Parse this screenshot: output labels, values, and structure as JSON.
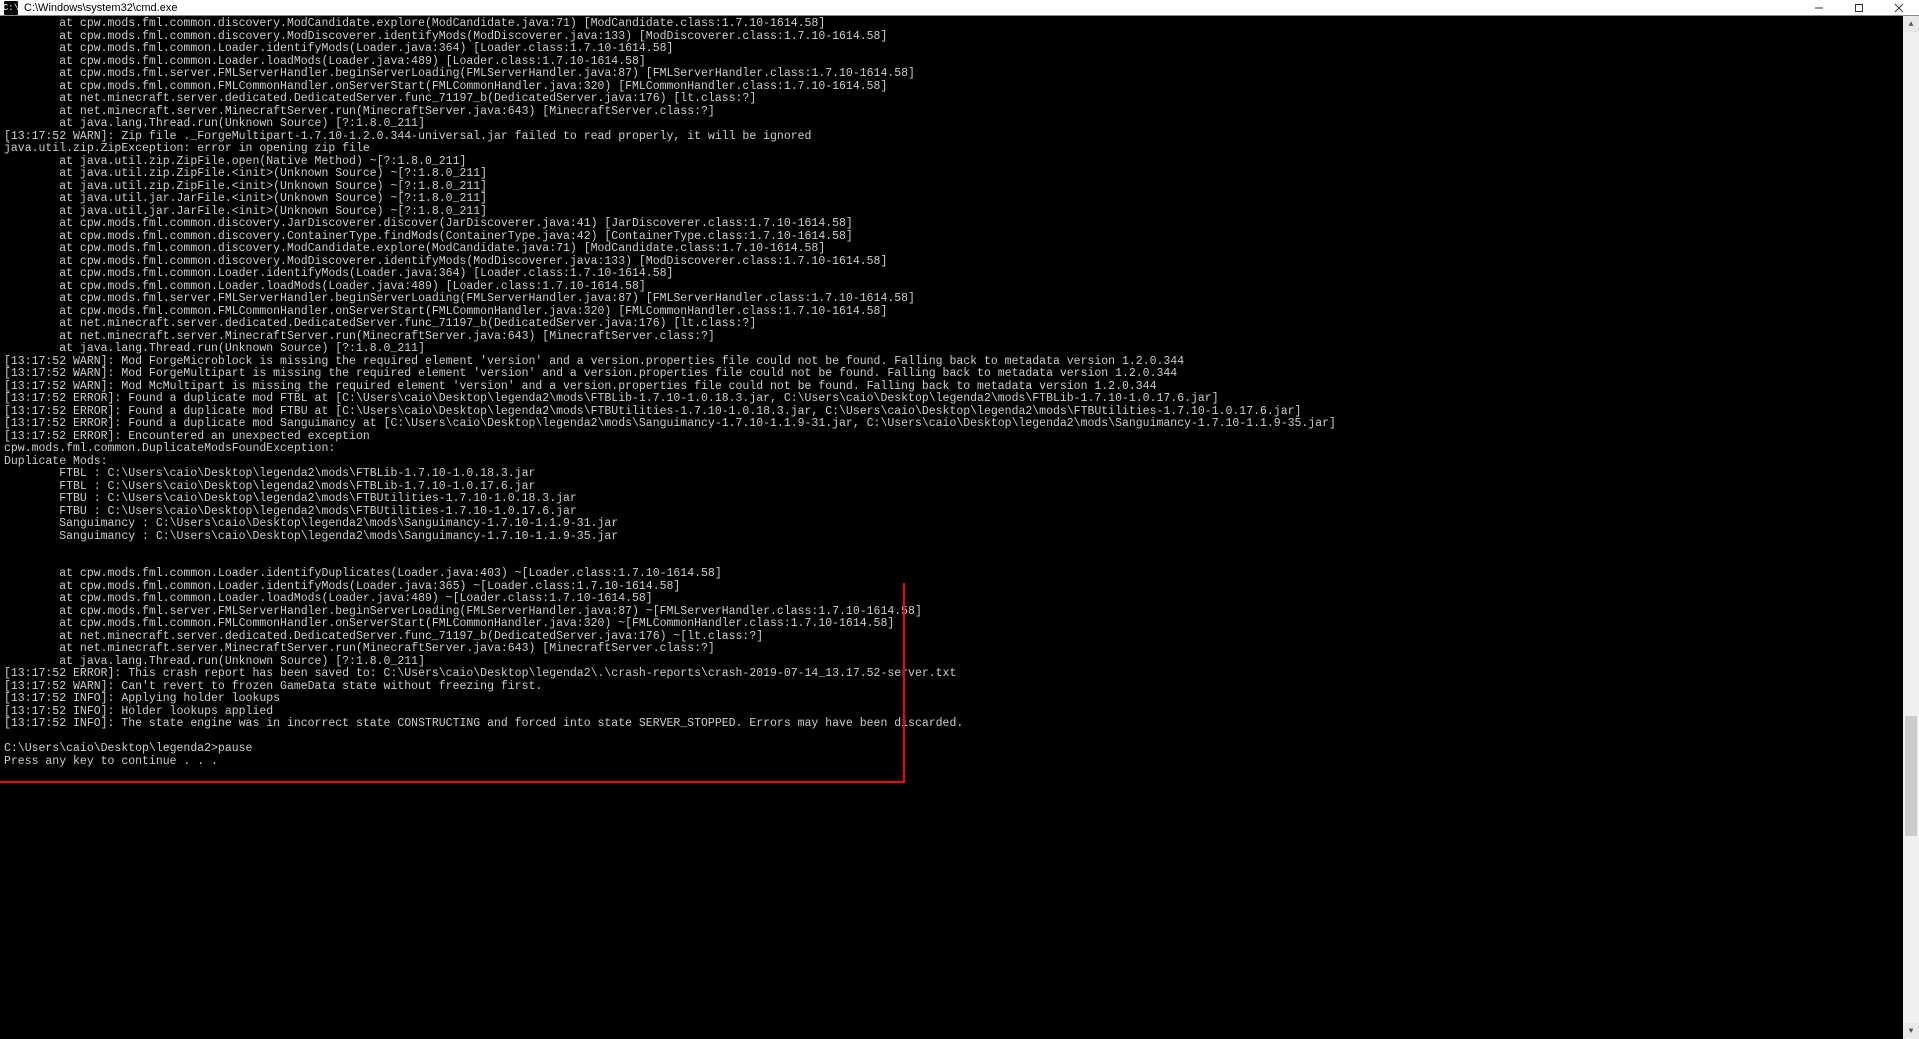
{
  "titlebar": {
    "icon_label": "C:\\",
    "title": "C:\\Windows\\system32\\cmd.exe"
  },
  "win_controls": {
    "minimize": "minimize-icon",
    "maximize": "maximize-icon",
    "close": "close-icon"
  },
  "highlight": {
    "color": "#ff0000",
    "present": true
  },
  "console_lines": [
    "        at cpw.mods.fml.common.discovery.ModCandidate.explore(ModCandidate.java:71) [ModCandidate.class:1.7.10-1614.58]",
    "        at cpw.mods.fml.common.discovery.ModDiscoverer.identifyMods(ModDiscoverer.java:133) [ModDiscoverer.class:1.7.10-1614.58]",
    "        at cpw.mods.fml.common.Loader.identifyMods(Loader.java:364) [Loader.class:1.7.10-1614.58]",
    "        at cpw.mods.fml.common.Loader.loadMods(Loader.java:489) [Loader.class:1.7.10-1614.58]",
    "        at cpw.mods.fml.server.FMLServerHandler.beginServerLoading(FMLServerHandler.java:87) [FMLServerHandler.class:1.7.10-1614.58]",
    "        at cpw.mods.fml.common.FMLCommonHandler.onServerStart(FMLCommonHandler.java:320) [FMLCommonHandler.class:1.7.10-1614.58]",
    "        at net.minecraft.server.dedicated.DedicatedServer.func_71197_b(DedicatedServer.java:176) [lt.class:?]",
    "        at net.minecraft.server.MinecraftServer.run(MinecraftServer.java:643) [MinecraftServer.class:?]",
    "        at java.lang.Thread.run(Unknown Source) [?:1.8.0_211]",
    "[13:17:52 WARN]: Zip file ._ForgeMultipart-1.7.10-1.2.0.344-universal.jar failed to read properly, it will be ignored",
    "java.util.zip.ZipException: error in opening zip file",
    "        at java.util.zip.ZipFile.open(Native Method) ~[?:1.8.0_211]",
    "        at java.util.zip.ZipFile.<init>(Unknown Source) ~[?:1.8.0_211]",
    "        at java.util.zip.ZipFile.<init>(Unknown Source) ~[?:1.8.0_211]",
    "        at java.util.jar.JarFile.<init>(Unknown Source) ~[?:1.8.0_211]",
    "        at java.util.jar.JarFile.<init>(Unknown Source) ~[?:1.8.0_211]",
    "        at cpw.mods.fml.common.discovery.JarDiscoverer.discover(JarDiscoverer.java:41) [JarDiscoverer.class:1.7.10-1614.58]",
    "        at cpw.mods.fml.common.discovery.ContainerType.findMods(ContainerType.java:42) [ContainerType.class:1.7.10-1614.58]",
    "        at cpw.mods.fml.common.discovery.ModCandidate.explore(ModCandidate.java:71) [ModCandidate.class:1.7.10-1614.58]",
    "        at cpw.mods.fml.common.discovery.ModDiscoverer.identifyMods(ModDiscoverer.java:133) [ModDiscoverer.class:1.7.10-1614.58]",
    "        at cpw.mods.fml.common.Loader.identifyMods(Loader.java:364) [Loader.class:1.7.10-1614.58]",
    "        at cpw.mods.fml.common.Loader.loadMods(Loader.java:489) [Loader.class:1.7.10-1614.58]",
    "        at cpw.mods.fml.server.FMLServerHandler.beginServerLoading(FMLServerHandler.java:87) [FMLServerHandler.class:1.7.10-1614.58]",
    "        at cpw.mods.fml.common.FMLCommonHandler.onServerStart(FMLCommonHandler.java:320) [FMLCommonHandler.class:1.7.10-1614.58]",
    "        at net.minecraft.server.dedicated.DedicatedServer.func_71197_b(DedicatedServer.java:176) [lt.class:?]",
    "        at net.minecraft.server.MinecraftServer.run(MinecraftServer.java:643) [MinecraftServer.class:?]",
    "        at java.lang.Thread.run(Unknown Source) [?:1.8.0_211]",
    "[13:17:52 WARN]: Mod ForgeMicroblock is missing the required element 'version' and a version.properties file could not be found. Falling back to metadata version 1.2.0.344",
    "[13:17:52 WARN]: Mod ForgeMultipart is missing the required element 'version' and a version.properties file could not be found. Falling back to metadata version 1.2.0.344",
    "[13:17:52 WARN]: Mod McMultipart is missing the required element 'version' and a version.properties file could not be found. Falling back to metadata version 1.2.0.344",
    "[13:17:52 ERROR]: Found a duplicate mod FTBL at [C:\\Users\\caio\\Desktop\\legenda2\\mods\\FTBLib-1.7.10-1.0.18.3.jar, C:\\Users\\caio\\Desktop\\legenda2\\mods\\FTBLib-1.7.10-1.0.17.6.jar]",
    "[13:17:52 ERROR]: Found a duplicate mod FTBU at [C:\\Users\\caio\\Desktop\\legenda2\\mods\\FTBUtilities-1.7.10-1.0.18.3.jar, C:\\Users\\caio\\Desktop\\legenda2\\mods\\FTBUtilities-1.7.10-1.0.17.6.jar]",
    "[13:17:52 ERROR]: Found a duplicate mod Sanguimancy at [C:\\Users\\caio\\Desktop\\legenda2\\mods\\Sanguimancy-1.7.10-1.1.9-31.jar, C:\\Users\\caio\\Desktop\\legenda2\\mods\\Sanguimancy-1.7.10-1.1.9-35.jar]",
    "[13:17:52 ERROR]: Encountered an unexpected exception",
    "cpw.mods.fml.common.DuplicateModsFoundException:",
    "Duplicate Mods:",
    "        FTBL : C:\\Users\\caio\\Desktop\\legenda2\\mods\\FTBLib-1.7.10-1.0.18.3.jar",
    "        FTBL : C:\\Users\\caio\\Desktop\\legenda2\\mods\\FTBLib-1.7.10-1.0.17.6.jar",
    "        FTBU : C:\\Users\\caio\\Desktop\\legenda2\\mods\\FTBUtilities-1.7.10-1.0.18.3.jar",
    "        FTBU : C:\\Users\\caio\\Desktop\\legenda2\\mods\\FTBUtilities-1.7.10-1.0.17.6.jar",
    "        Sanguimancy : C:\\Users\\caio\\Desktop\\legenda2\\mods\\Sanguimancy-1.7.10-1.1.9-31.jar",
    "        Sanguimancy : C:\\Users\\caio\\Desktop\\legenda2\\mods\\Sanguimancy-1.7.10-1.1.9-35.jar",
    "",
    "",
    "        at cpw.mods.fml.common.Loader.identifyDuplicates(Loader.java:403) ~[Loader.class:1.7.10-1614.58]",
    "        at cpw.mods.fml.common.Loader.identifyMods(Loader.java:365) ~[Loader.class:1.7.10-1614.58]",
    "        at cpw.mods.fml.common.Loader.loadMods(Loader.java:489) ~[Loader.class:1.7.10-1614.58]",
    "        at cpw.mods.fml.server.FMLServerHandler.beginServerLoading(FMLServerHandler.java:87) ~[FMLServerHandler.class:1.7.10-1614.58]",
    "        at cpw.mods.fml.common.FMLCommonHandler.onServerStart(FMLCommonHandler.java:320) ~[FMLCommonHandler.class:1.7.10-1614.58]",
    "        at net.minecraft.server.dedicated.DedicatedServer.func_71197_b(DedicatedServer.java:176) ~[lt.class:?]",
    "        at net.minecraft.server.MinecraftServer.run(MinecraftServer.java:643) [MinecraftServer.class:?]",
    "        at java.lang.Thread.run(Unknown Source) [?:1.8.0_211]",
    "[13:17:52 ERROR]: This crash report has been saved to: C:\\Users\\caio\\Desktop\\legenda2\\.\\crash-reports\\crash-2019-07-14_13.17.52-server.txt",
    "[13:17:52 WARN]: Can't revert to frozen GameData state without freezing first.",
    "[13:17:52 INFO]: Applying holder lookups",
    "[13:17:52 INFO]: Holder lookups applied",
    "[13:17:52 INFO]: The state engine was in incorrect state CONSTRUCTING and forced into state SERVER_STOPPED. Errors may have been discarded.",
    "",
    "C:\\Users\\caio\\Desktop\\legenda2>pause",
    "Press any key to continue . . ."
  ]
}
